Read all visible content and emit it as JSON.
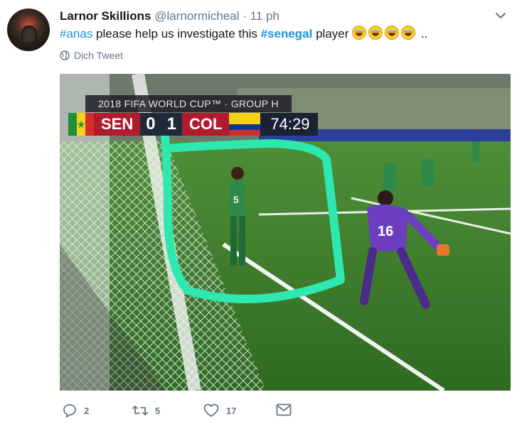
{
  "tweet": {
    "author_name": "Larnor Skillions",
    "author_handle": "@larnormicheal",
    "separator": "·",
    "time": "11 ph",
    "text_parts": {
      "hashtag1": "#anas",
      "mid": " please help us investigate this ",
      "hashtag2": "#senegal",
      "end": " player ",
      "tail": " .."
    },
    "emoji_count": 4,
    "translate_label": "Dịch Tweet"
  },
  "media": {
    "overlay": {
      "tournament": "2018 FIFA WORLD CUP™ · GROUP H",
      "home_team": "SEN",
      "home_score": "0",
      "away_score": "1",
      "away_team": "COL",
      "clock": "74:29"
    },
    "players": {
      "left_number": "5",
      "keeper_number": "16"
    }
  },
  "actions": {
    "reply_count": "2",
    "retweet_count": "5",
    "like_count": "17"
  },
  "colors": {
    "link": "#1b95e0",
    "meta": "#657786",
    "pitch": "#3f7d2e",
    "circle_annotation": "#2ee8b0"
  }
}
